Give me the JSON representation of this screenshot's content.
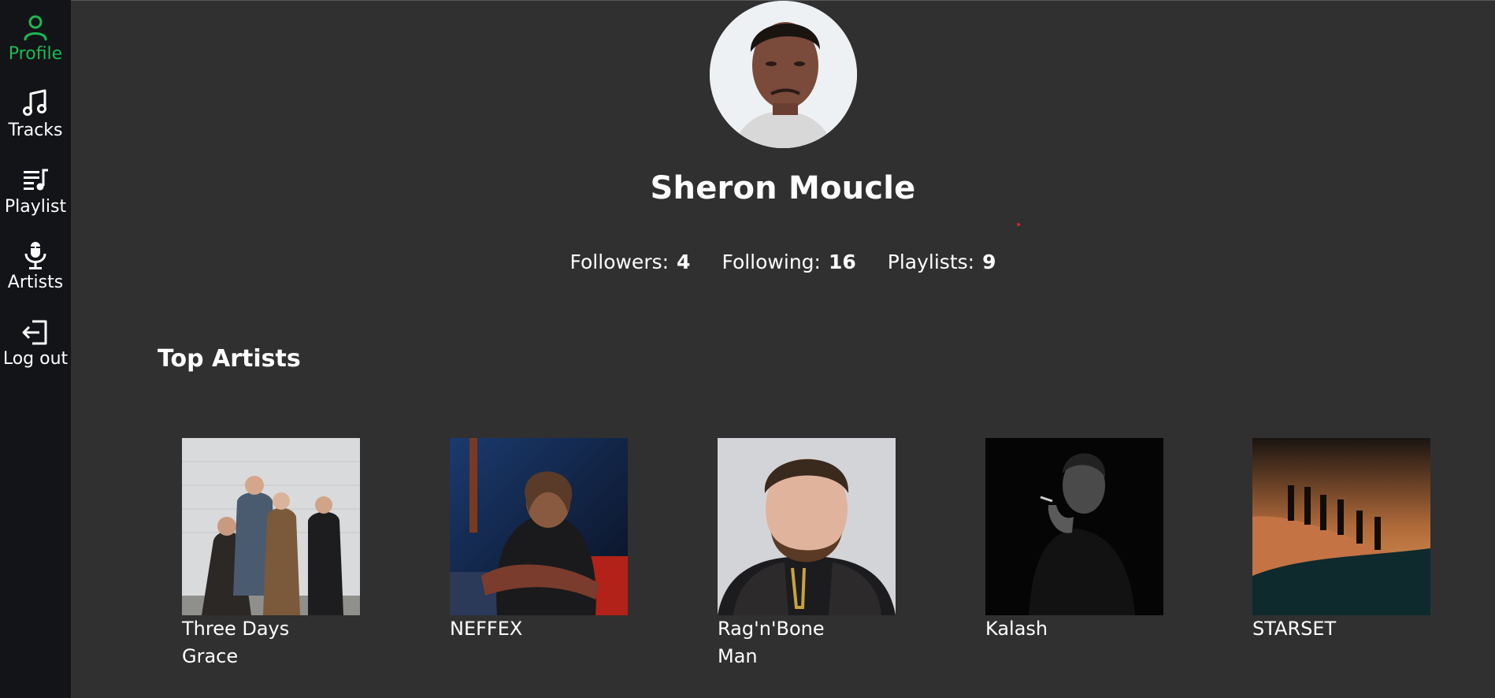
{
  "sidebar": {
    "items": [
      {
        "label": "Profile",
        "icon": "user-icon",
        "active": true
      },
      {
        "label": "Tracks",
        "icon": "music-note-icon"
      },
      {
        "label": "Playlist",
        "icon": "playlist-icon"
      },
      {
        "label": "Artists",
        "icon": "microphone-icon"
      },
      {
        "label": "Log out",
        "icon": "logout-icon"
      }
    ],
    "accent_color": "#1db954"
  },
  "profile": {
    "name": "Sheron Moucle",
    "stats": [
      {
        "label": "Followers:",
        "value": "4"
      },
      {
        "label": "Following:",
        "value": "16"
      },
      {
        "label": "Playlists:",
        "value": "9"
      }
    ]
  },
  "top_artists": {
    "title": "Top Artists",
    "items": [
      {
        "name": "Three Days Grace"
      },
      {
        "name": "NEFFEX"
      },
      {
        "name": "Rag'n'Bone Man"
      },
      {
        "name": "Kalash"
      },
      {
        "name": "STARSET"
      }
    ]
  }
}
